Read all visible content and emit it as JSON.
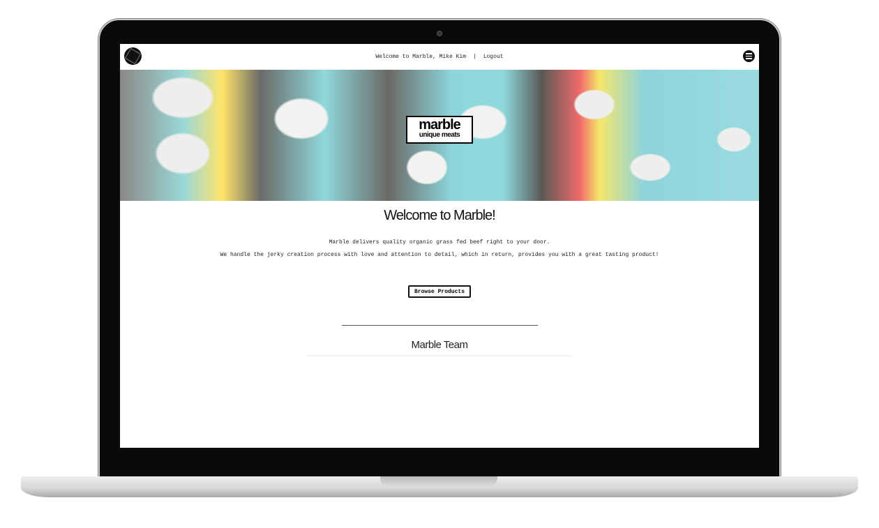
{
  "nav": {
    "welcome": "Welcome to Marble, Mike Kim",
    "separator": "|",
    "logout": "Logout"
  },
  "hero": {
    "brand_name": "marble",
    "brand_tagline": "unique meats"
  },
  "main": {
    "title": "Welcome to Marble!",
    "line1": "Marble delivers quality organic grass fed beef right to your door.",
    "line2": "We handle the jerky creation process with love and attention to detail, which in return, provides you with a great tasting product!",
    "browse_button": "Browse Products",
    "team_heading": "Marble Team"
  }
}
